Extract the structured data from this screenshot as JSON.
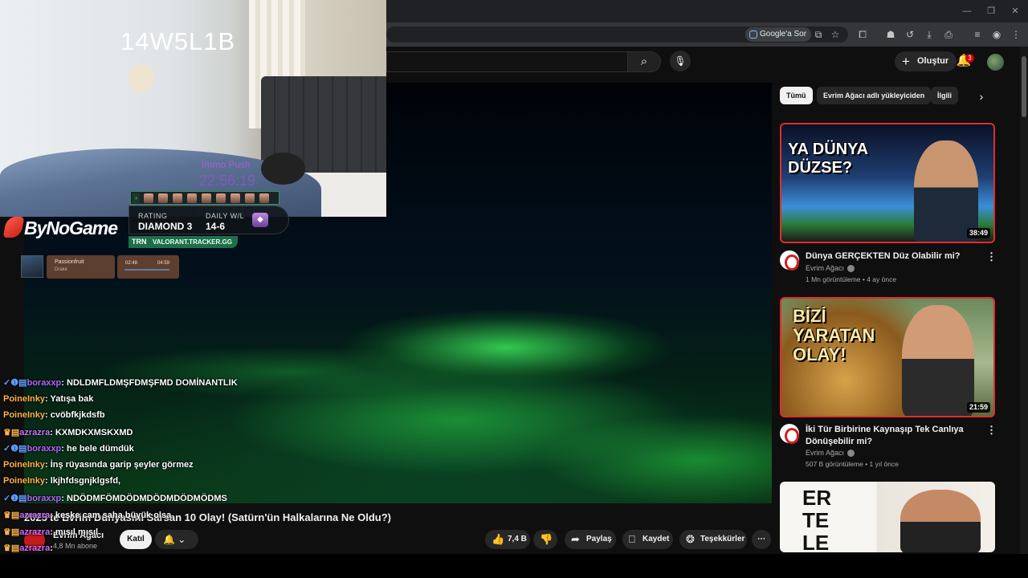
{
  "browser": {
    "google_pill": "Google'a Sor",
    "icons": [
      "screen-share-icon",
      "star-icon",
      "extensions-icon",
      "incognito-icon",
      "history-icon",
      "download-icon",
      "translate-icon",
      "reading-list-icon",
      "profile-icon",
      "menu-icon"
    ]
  },
  "header": {
    "create_label": "Oluştur",
    "notification_count": "3"
  },
  "stream": {
    "cam_code": "14W5L1B",
    "immortal_label": "İmmo Push",
    "immortal_time": "22:56:19",
    "rating_label": "RATING",
    "rating_value": "DIAMOND 3",
    "daily_label": "DAILY W/L",
    "daily_value": "14-6",
    "tracker_logo": "TRN",
    "tracker_url": "VALORANT.TRACKER.GG",
    "brand": "ByNoGame",
    "music": {
      "title": "Passionfruit",
      "artist": "Drake",
      "time_start": "02:48",
      "time_end": "04:59"
    }
  },
  "chat": [
    {
      "badges": "✓❶▤",
      "user": "boraxxp",
      "color": "purple",
      "text": "NDLDMFLDMŞFDMŞFMD DOMİNANTLIK"
    },
    {
      "badges": "",
      "user": "PoineInky",
      "color": "orange",
      "text": "Yatışa bak"
    },
    {
      "badges": "",
      "user": "PoineInky",
      "color": "orange",
      "text": "cvöbfkjkdsfb"
    },
    {
      "badges": "♛▤",
      "user": "azrazra",
      "color": "pink",
      "text": "KXMDKXMSKXMD"
    },
    {
      "badges": "✓❶▤",
      "user": "boraxxp",
      "color": "purple",
      "text": "he bele dümdük"
    },
    {
      "badges": "",
      "user": "PoineInky",
      "color": "orange",
      "text": "İnş rüyasında garip şeyler görmez"
    },
    {
      "badges": "",
      "user": "PoineInky",
      "color": "orange",
      "text": "lkjhfdsgnjklgsfd,"
    },
    {
      "badges": "✓❶▤",
      "user": "boraxxp",
      "color": "purple",
      "text": "NDÖDMFÖMDÖDMDÖDMDÖDMÖDMS"
    },
    {
      "badges": "♛▤",
      "user": "azrazra",
      "color": "pink",
      "text": "keşke cam saha büyük olsa"
    },
    {
      "badges": "♛▤",
      "user": "azrazra",
      "color": "pink",
      "text": "mısıl mısıl"
    },
    {
      "badges": "♛▤",
      "user": "azrazra",
      "color": "pink",
      "text": ""
    }
  ],
  "video": {
    "title": "2025'te Evrim Dünyasını Sarsan 10 Olay! (Satürn'ün Halkalarına Ne Oldu?)",
    "channel": "Evrim Ağacı",
    "subscribers": "4,8 Mn abone",
    "join_label": "Katıl",
    "likes": "7,4 B",
    "share_label": "Paylaş",
    "save_label": "Kaydet",
    "thanks_label": "Teşekkürler"
  },
  "chips": [
    "Tümü",
    "Evrim Ağacı adlı yükleyiciden",
    "İlgili"
  ],
  "related": [
    {
      "title": "Dünya GERÇEKTEN Düz Olabilir mi?",
      "channel": "Evrim Ağacı",
      "meta": "1 Mn görüntüleme • 4 ay önce",
      "duration": "38:49",
      "art": "YA DÜNYA DÜZSE?"
    },
    {
      "title": "İki Tür Birbirine Kaynaşıp Tek Canlıya Dönüşebilir mi?",
      "channel": "Evrim Ağacı",
      "meta": "507 B görüntüleme • 1 yıl önce",
      "duration": "21:59",
      "art": "BİZİ YARATAN OLAY!"
    },
    {
      "art": "ER TE LE"
    }
  ]
}
